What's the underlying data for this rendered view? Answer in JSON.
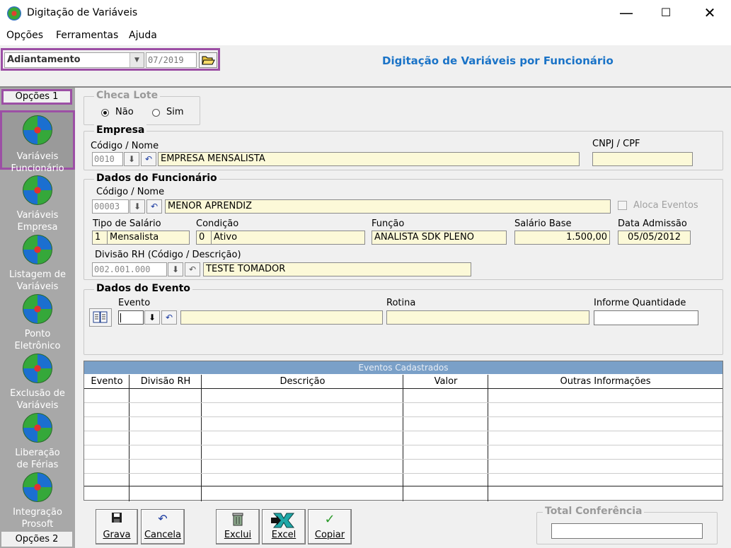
{
  "window": {
    "title": "Digitação de Variáveis",
    "minimize": "—",
    "maximize": "☐",
    "close": "✕"
  },
  "menu": [
    "Opções",
    "Ferramentas",
    "Ajuda"
  ],
  "filter": {
    "period": "Adiantamento",
    "date": "07/2019"
  },
  "heading": "Digitação de Variáveis por Funcionário",
  "sidebar": {
    "group1": "Opções 1",
    "group2": "Opções 2",
    "items": [
      {
        "line1": "Variáveis",
        "line2": "Funcionário"
      },
      {
        "line1": "Variáveis",
        "line2": "Empresa"
      },
      {
        "line1": "Listagem de",
        "line2": "Variáveis"
      },
      {
        "line1": "Ponto",
        "line2": "Eletrônico"
      },
      {
        "line1": "Exclusão de",
        "line2": "Variáveis"
      },
      {
        "line1": "Liberação",
        "line2": "de Férias"
      },
      {
        "line1": "Integração",
        "line2": "Prosoft"
      }
    ]
  },
  "checa_lote": {
    "title": "Checa Lote",
    "option_no": "Não",
    "option_yes": "Sim",
    "selected": "Não"
  },
  "empresa": {
    "title": "Empresa",
    "code_label": "Código / Nome",
    "code": "0010",
    "name": "EMPRESA MENSALISTA",
    "cnpj_label": "CNPJ / CPF",
    "cnpj": ""
  },
  "funcionario": {
    "title": "Dados do Funcionário",
    "code_label": "Código / Nome",
    "code": "00003",
    "name": "MENOR APRENDIZ",
    "aloca_label": "Aloca Eventos",
    "tipo_label": "Tipo de Salário",
    "tipo_code": "1",
    "tipo_desc": "Mensalista",
    "condicao_label": "Condição",
    "condicao_code": "0",
    "condicao_desc": "Ativo",
    "funcao_label": "Função",
    "funcao": "ANALISTA SDK PLENO",
    "salario_label": "Salário Base",
    "salario": "1.500,00",
    "admissao_label": "Data Admissão",
    "admissao": "05/05/2012",
    "divisao_label": "Divisão RH (Código / Descrição)",
    "divisao_code": "002.001.000",
    "divisao_desc": "TESTE TOMADOR"
  },
  "evento": {
    "title": "Dados do Evento",
    "evento_label": "Evento",
    "rotina_label": "Rotina",
    "quantidade_label": "Informe Quantidade"
  },
  "table": {
    "caption": "Eventos Cadastrados",
    "columns": [
      "Evento",
      "Divisão RH",
      "Descrição",
      "Valor",
      "Outras Informações"
    ]
  },
  "buttons": {
    "grava": "Grava",
    "cancela": "Cancela",
    "exclui": "Exclui",
    "excel": "Excel",
    "copiar": "Copiar"
  },
  "total": {
    "title": "Total Conferência",
    "value": ""
  }
}
